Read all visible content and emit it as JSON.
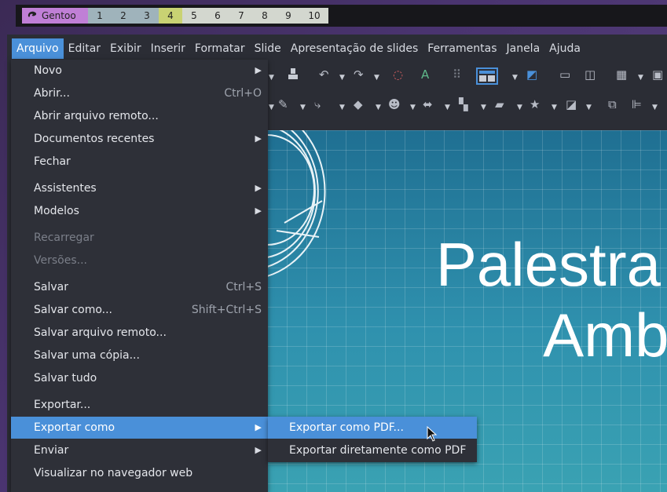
{
  "panel": {
    "distro_label": "Gentoo",
    "workspaces": [
      "1",
      "2",
      "3",
      "4",
      "5",
      "6",
      "7",
      "8",
      "9",
      "10"
    ],
    "current_workspace": "4"
  },
  "menubar": {
    "items": [
      "Arquivo",
      "Editar",
      "Exibir",
      "Inserir",
      "Formatar",
      "Slide",
      "Apresentação de slides",
      "Ferramentas",
      "Janela",
      "Ajuda"
    ],
    "active": "Arquivo"
  },
  "file_menu": {
    "items": [
      {
        "label": "Novo",
        "has_submenu": true
      },
      {
        "label": "Abrir...",
        "shortcut": "Ctrl+O"
      },
      {
        "label": "Abrir arquivo remoto..."
      },
      {
        "label": "Documentos recentes",
        "has_submenu": true
      },
      {
        "label": "Fechar"
      },
      {
        "label": "Assistentes",
        "has_submenu": true
      },
      {
        "label": "Modelos",
        "has_submenu": true
      },
      {
        "label": "Recarregar",
        "disabled": true
      },
      {
        "label": "Versões...",
        "disabled": true
      },
      {
        "label": "Salvar",
        "shortcut": "Ctrl+S"
      },
      {
        "label": "Salvar como...",
        "shortcut": "Shift+Ctrl+S"
      },
      {
        "label": "Salvar arquivo remoto..."
      },
      {
        "label": "Salvar uma cópia..."
      },
      {
        "label": "Salvar tudo"
      },
      {
        "label": "Exportar..."
      },
      {
        "label": "Exportar como",
        "has_submenu": true,
        "highlighted": true
      },
      {
        "label": "Enviar",
        "has_submenu": true
      },
      {
        "label": "Visualizar no navegador web"
      }
    ]
  },
  "export_submenu": {
    "items": [
      {
        "label": "Exportar como PDF...",
        "highlighted": true
      },
      {
        "label": "Exportar diretamente como PDF"
      }
    ]
  },
  "slide": {
    "title_line1": "Palestra so",
    "title_line2": "Ambi"
  },
  "colors": {
    "accent": "#4a90d9",
    "menu_bg": "#2e3038",
    "slide_bg": "#2d8cab",
    "workspace_current": "#c9d273",
    "distro_tag": "#c07fd6"
  }
}
